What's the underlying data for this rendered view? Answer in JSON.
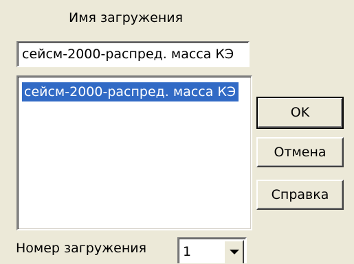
{
  "dialog": {
    "title_label": "Имя загружения",
    "name_input_value": "сейсм-2000-распред. масса КЭ",
    "list_items": [
      "сейсм-2000-распред. масса КЭ"
    ],
    "buttons": {
      "ok": "OK",
      "cancel": "Отмена",
      "help": "Справка"
    },
    "number_label": "Номер загружения",
    "number_value": "1",
    "combo_arrow_icon": "chevron-down-icon"
  },
  "colors": {
    "face": "#ece9d8",
    "selection": "#316ac5"
  }
}
